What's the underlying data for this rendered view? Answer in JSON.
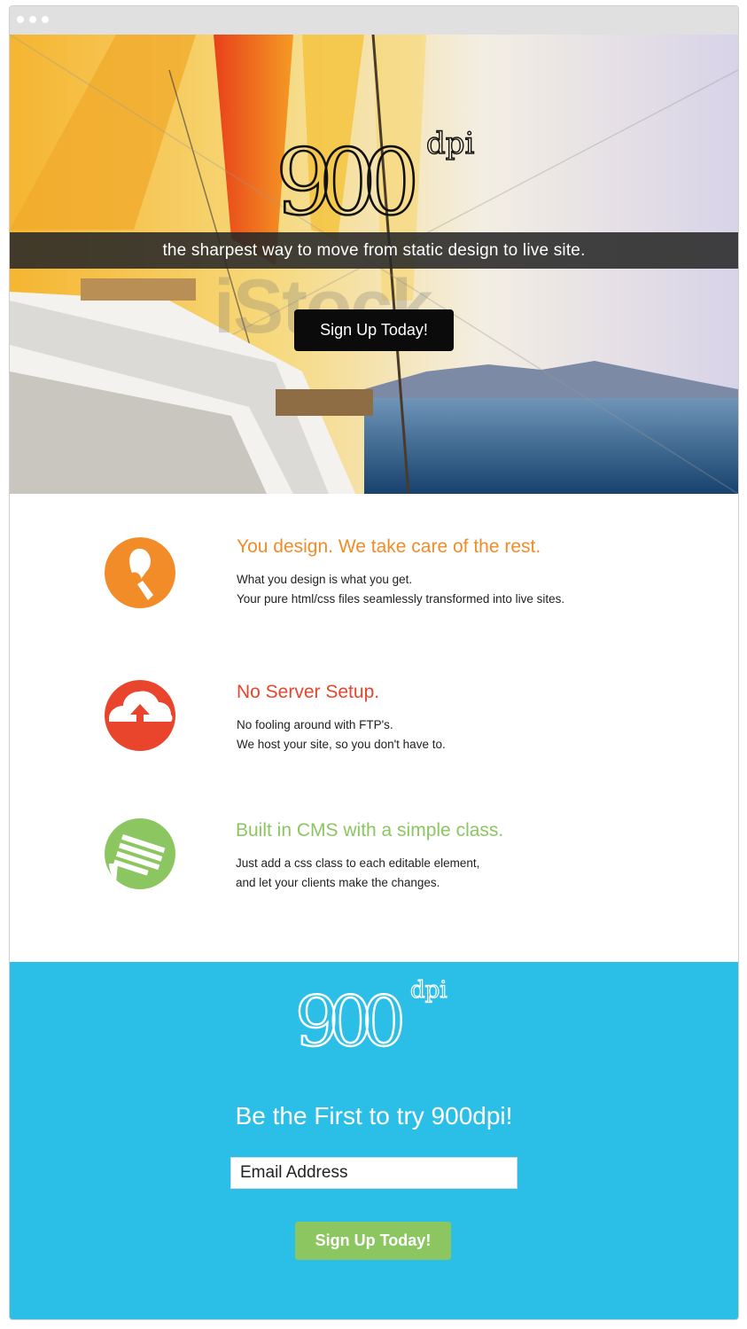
{
  "colors": {
    "accent_orange": "#f28c28",
    "accent_red": "#e8452c",
    "accent_green": "#8bc660",
    "cta_blue": "#2bbfe8",
    "hero_button": "#0b0b0b"
  },
  "hero": {
    "logo_number": "900",
    "logo_suffix": "dpi",
    "tagline": "the sharpest way to move from static design to live site.",
    "button_label": "Sign Up Today!"
  },
  "features": [
    {
      "title": "You design. We take care of the rest.",
      "color": "#f28c28",
      "icon": "paintbrush-icon",
      "lines": [
        "What you design is what you get.",
        "Your pure html/css files seamlessly transformed into live sites."
      ]
    },
    {
      "title": "No Server Setup.",
      "color": "#e8452c",
      "icon": "cloud-upload-icon",
      "lines": [
        "No fooling around with FTP's.",
        "We host your site, so you don't have to."
      ]
    },
    {
      "title": "Built in CMS with a simple class.",
      "color": "#8bc660",
      "icon": "notepad-icon",
      "lines": [
        "Just add a css class to each editable element,",
        "and let your clients make the changes."
      ]
    }
  ],
  "cta": {
    "logo_number": "900",
    "logo_suffix": "dpi",
    "headline": "Be the First to try 900dpi!",
    "email_placeholder": "Email Address",
    "button_label": "Sign Up Today!"
  }
}
